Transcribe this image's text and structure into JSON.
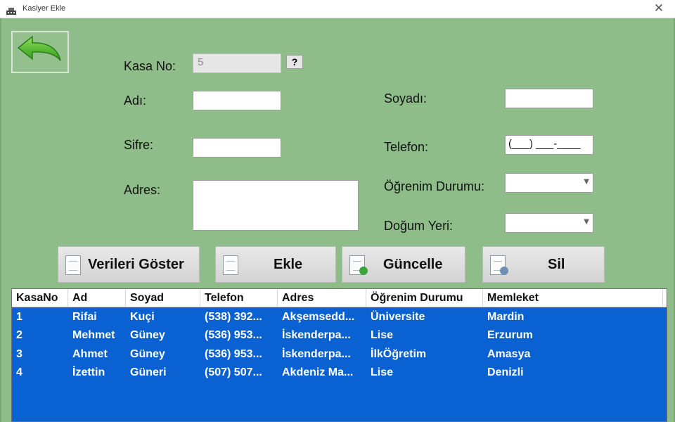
{
  "window": {
    "title": "Kasiyer Ekle",
    "close_glyph": "✕",
    "icon": "cash-register-icon"
  },
  "colors": {
    "background": "#8fbd8a",
    "grid_selection": "#0a62d2",
    "back_arrow": "#4caf2a"
  },
  "form": {
    "kasa_no_label": "Kasa No:",
    "kasa_no_value": "5",
    "help_label": "?",
    "adi_label": "Adı:",
    "soyadi_label": "Soyadı:",
    "sifre_label": "Sifre:",
    "telefon_label": "Telefon:",
    "telefon_mask": "(___) ___-____",
    "adres_label": "Adres:",
    "ogrenim_label": "Öğrenim Durumu:",
    "dogum_yeri_label": "Doğum Yeri:"
  },
  "buttons": {
    "verileri_goster": "Verileri Göster",
    "ekle": "Ekle",
    "guncelle": "Güncelle",
    "sil": "Sil"
  },
  "grid": {
    "columns": [
      "KasaNo",
      "Ad",
      "Soyad",
      "Telefon",
      "Adres",
      "Öğrenim Durumu",
      "Memleket"
    ],
    "rows": [
      [
        "1",
        "Rifai",
        "Kuçi",
        "(538) 392...",
        "Akşemsedd...",
        "Üniversite",
        "Mardin"
      ],
      [
        "2",
        "Mehmet",
        "Güney",
        "(536) 953...",
        "İskenderpa...",
        "Lise",
        "Erzurum"
      ],
      [
        "3",
        "Ahmet",
        "Güney",
        "(536) 953...",
        "İskenderpa...",
        "İlkÖğretim",
        "Amasya"
      ],
      [
        "4",
        "İzettin",
        "Güneri",
        "(507) 507...",
        "Akdeniz Ma...",
        "Lise",
        "Denizli"
      ]
    ]
  }
}
